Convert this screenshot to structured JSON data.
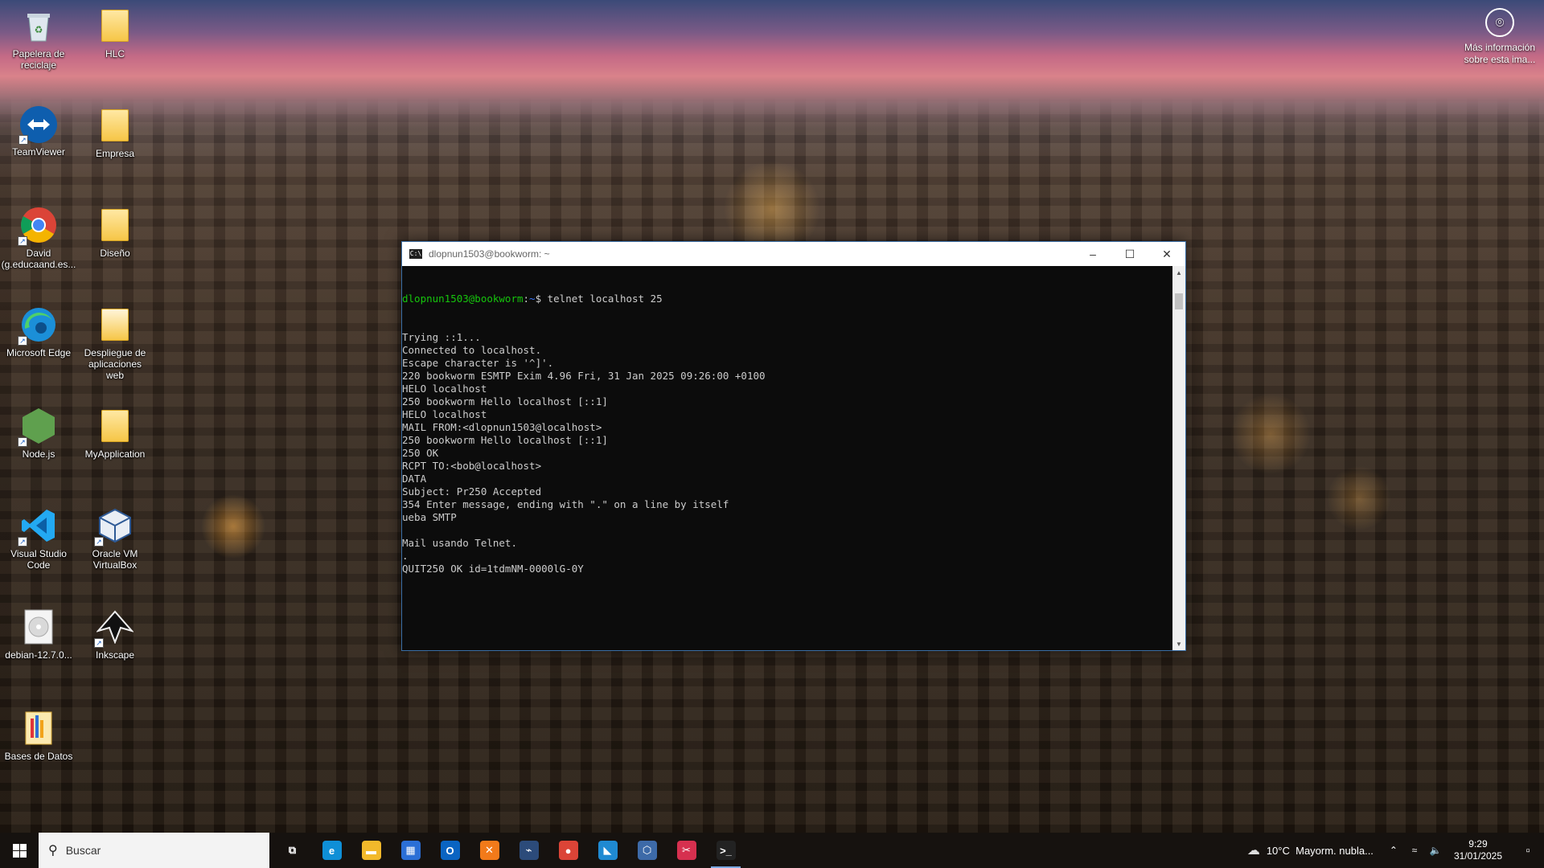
{
  "desktop": {
    "icons": [
      {
        "label": "Papelera de reciclaje",
        "icon": "recycle-bin-icon"
      },
      {
        "label": "HLC",
        "icon": "folder-icon"
      },
      {
        "label": "TeamViewer",
        "icon": "teamviewer-icon"
      },
      {
        "label": "Empresa",
        "icon": "folder-icon"
      },
      {
        "label": "David (g.educaand.es...",
        "icon": "chrome-icon"
      },
      {
        "label": "Diseño",
        "icon": "folder-icon"
      },
      {
        "label": "Microsoft Edge",
        "icon": "edge-icon"
      },
      {
        "label": "Despliegue de aplicaciones web",
        "icon": "folder-icon"
      },
      {
        "label": "Node.js",
        "icon": "nodejs-icon"
      },
      {
        "label": "MyApplication",
        "icon": "folder-icon"
      },
      {
        "label": "Visual Studio Code",
        "icon": "vscode-icon"
      },
      {
        "label": "Oracle VM VirtualBox",
        "icon": "virtualbox-icon"
      },
      {
        "label": "debian-12.7.0...",
        "icon": "disc-image-icon"
      },
      {
        "label": "Inkscape",
        "icon": "inkscape-icon"
      },
      {
        "label": "Bases de Datos",
        "icon": "database-folder-icon"
      }
    ],
    "info": {
      "label": "Más información sobre esta ima..."
    }
  },
  "terminal": {
    "title": "dlopnun1503@bookworm: ~",
    "prompt_user": "dlopnun1503@bookworm",
    "prompt_path": "~",
    "prompt_symbol": "$",
    "command": " telnet localhost 25",
    "output": [
      "Trying ::1...",
      "Connected to localhost.",
      "Escape character is '^]'.",
      "220 bookworm ESMTP Exim 4.96 Fri, 31 Jan 2025 09:26:00 +0100",
      "HELO localhost",
      "250 bookworm Hello localhost [::1]",
      "HELO localhost",
      "MAIL FROM:<dlopnun1503@localhost>",
      "250 bookworm Hello localhost [::1]",
      "250 OK",
      "RCPT TO:<bob@localhost>",
      "DATA",
      "Subject: Pr250 Accepted",
      "354 Enter message, ending with \".\" on a line by itself",
      "ueba SMTP",
      "",
      "Mail usando Telnet.",
      ".",
      "QUIT250 OK id=1tdmNM-0000lG-0Y"
    ]
  },
  "taskbar": {
    "search_placeholder": "Buscar",
    "apps": [
      {
        "name": "task-view",
        "icon": "task-view-icon",
        "glyph": "⧉",
        "color": "#00000000"
      },
      {
        "name": "edge",
        "icon": "edge-icon",
        "glyph": "e",
        "color": "#0f8fd6"
      },
      {
        "name": "file-explorer",
        "icon": "folder-icon",
        "glyph": "▬",
        "color": "#f2b92b"
      },
      {
        "name": "microsoft-store",
        "icon": "store-icon",
        "glyph": "▦",
        "color": "#2b6fd6"
      },
      {
        "name": "outlook",
        "icon": "outlook-icon",
        "glyph": "O",
        "color": "#0a64c2"
      },
      {
        "name": "xampp",
        "icon": "xampp-icon",
        "glyph": "✕",
        "color": "#f27a1a"
      },
      {
        "name": "mysql-workbench",
        "icon": "workbench-icon",
        "glyph": "⌁",
        "color": "#2c4b7a"
      },
      {
        "name": "chrome",
        "icon": "chrome-icon",
        "glyph": "●",
        "color": "#db4437"
      },
      {
        "name": "vscode",
        "icon": "vscode-icon",
        "glyph": "◣",
        "color": "#1f8ad2"
      },
      {
        "name": "virtualbox",
        "icon": "virtualbox-icon",
        "glyph": "⬡",
        "color": "#3d6aa8"
      },
      {
        "name": "snipping-tool",
        "icon": "snipping-icon",
        "glyph": "✂",
        "color": "#d6304f"
      },
      {
        "name": "terminal",
        "icon": "terminal-icon",
        "glyph": ">_",
        "color": "#222222"
      }
    ],
    "weather": {
      "temp": "10°C",
      "desc": "Mayorm. nubla..."
    },
    "clock": {
      "time": "9:29",
      "date": "31/01/2025"
    }
  }
}
